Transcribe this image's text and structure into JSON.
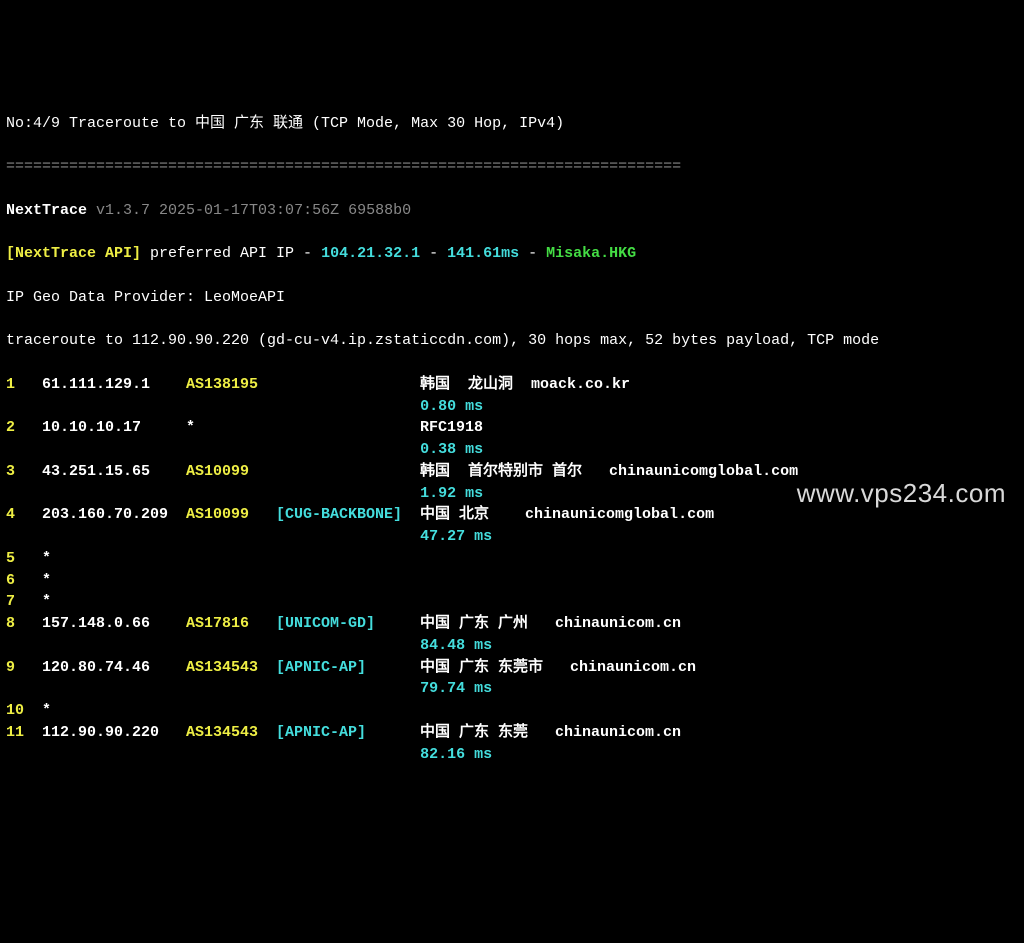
{
  "header": {
    "title_prefix": "No:4/9 Traceroute to ",
    "title_cn": "中国 广东 联通",
    "title_suffix": " (TCP Mode, Max 30 Hop, IPv4)",
    "separator": "==========================================================================="
  },
  "program": {
    "name": "NextTrace",
    "version": "v1.3.7 2025-01-17T03:07:56Z 69588b0"
  },
  "api_line": {
    "label": "[NextTrace API]",
    "text": " preferred API IP - ",
    "ip": "104.21.32.1",
    "sep1": " - ",
    "latency": "141.61ms",
    "sep2": " - ",
    "host": "Misaka.HKG"
  },
  "geo_provider": "IP Geo Data Provider: LeoMoeAPI",
  "trace_line": "traceroute to 112.90.90.220 (gd-cu-v4.ip.zstaticcdn.com), 30 hops max, 52 bytes payload, TCP mode",
  "hops": [
    {
      "n": "1",
      "ip": "61.111.129.1",
      "asn": "AS138195",
      "tag": "",
      "loc": "韩国  龙山洞  moack.co.kr",
      "ms": "0.80 ms"
    },
    {
      "n": "2",
      "ip": "10.10.10.17",
      "asn": "*",
      "tag": "",
      "loc": "RFC1918",
      "ms": "0.38 ms"
    },
    {
      "n": "3",
      "ip": "43.251.15.65",
      "asn": "AS10099",
      "tag": "",
      "loc": "韩国  首尔特别市 首尔   chinaunicomglobal.com",
      "ms": "1.92 ms"
    },
    {
      "n": "4",
      "ip": "203.160.70.209",
      "asn": "AS10099",
      "tag": "[CUG-BACKBONE]",
      "loc": "中国 北京    chinaunicomglobal.com",
      "ms": "47.27 ms"
    },
    {
      "n": "5",
      "ip": "*",
      "asn": "",
      "tag": "",
      "loc": "",
      "ms": ""
    },
    {
      "n": "6",
      "ip": "*",
      "asn": "",
      "tag": "",
      "loc": "",
      "ms": ""
    },
    {
      "n": "7",
      "ip": "*",
      "asn": "",
      "tag": "",
      "loc": "",
      "ms": ""
    },
    {
      "n": "8",
      "ip": "157.148.0.66",
      "asn": "AS17816",
      "tag": "[UNICOM-GD]",
      "loc": "中国 广东 广州   chinaunicom.cn",
      "ms": "84.48 ms"
    },
    {
      "n": "9",
      "ip": "120.80.74.46",
      "asn": "AS134543",
      "tag": "[APNIC-AP]",
      "loc": "中国 广东 东莞市   chinaunicom.cn",
      "ms": "79.74 ms"
    },
    {
      "n": "10",
      "ip": "*",
      "asn": "",
      "tag": "",
      "loc": "",
      "ms": ""
    },
    {
      "n": "11",
      "ip": "112.90.90.220",
      "asn": "AS134543",
      "tag": "[APNIC-AP]",
      "loc": "中国 广东 东莞   chinaunicom.cn",
      "ms": "82.16 ms"
    }
  ],
  "watermark": "www.vps234.com"
}
